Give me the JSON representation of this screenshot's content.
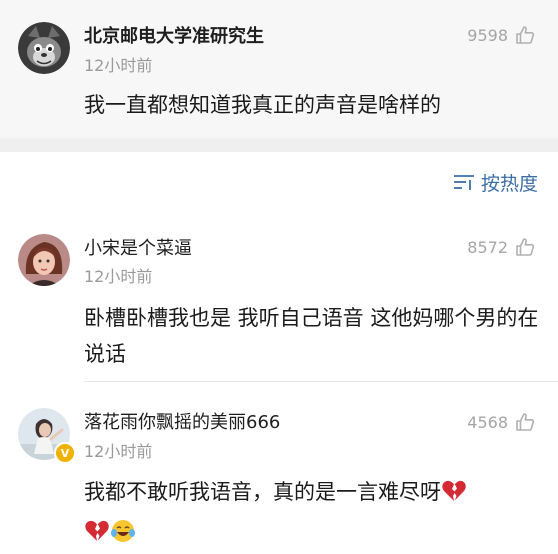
{
  "post": {
    "username": "北京邮电大学准研究生",
    "time": "12小时前",
    "likes": "9598",
    "text": "我一直都想知道我真正的声音是啥样的"
  },
  "sort": {
    "label": "按热度"
  },
  "comments": [
    {
      "username": "小宋是个菜逼",
      "time": "12小时前",
      "likes": "8572",
      "text": "卧槽卧槽我也是 我听自己语音 这他妈哪个男的在说话"
    },
    {
      "username": "落花雨你飘摇的美丽666",
      "time": "12小时前",
      "likes": "4568",
      "text": "我都不敢听我语音，真的是一言难尽呀",
      "emojis": [
        "broken-heart-icon",
        "broken-heart-icon",
        "crying-laughing-icon"
      ]
    }
  ],
  "colors": {
    "accent": "#3a6ea5",
    "meta": "#9a9a9a",
    "background_post": "#f7f7f7",
    "gap": "#efefef"
  }
}
